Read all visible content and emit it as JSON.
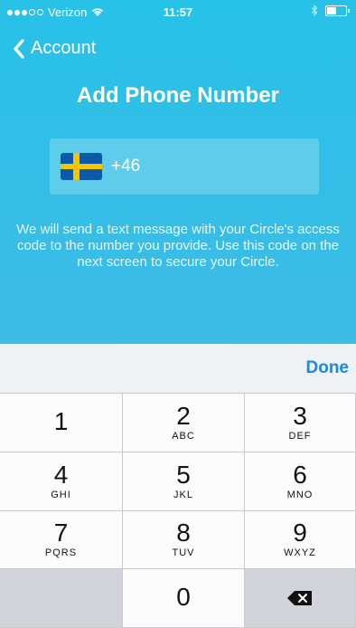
{
  "status": {
    "carrier": "Verizon",
    "time": "11:57"
  },
  "nav": {
    "back_label": "Account"
  },
  "page": {
    "title": "Add Phone Number",
    "phone_prefix": "+46",
    "info_text": "We will send a text message with your Circle's access code to the number you provide.  Use this code on the next screen to secure your Circle."
  },
  "keyboard": {
    "done_label": "Done",
    "keys": [
      {
        "num": "1",
        "letters": ""
      },
      {
        "num": "2",
        "letters": "ABC"
      },
      {
        "num": "3",
        "letters": "DEF"
      },
      {
        "num": "4",
        "letters": "GHI"
      },
      {
        "num": "5",
        "letters": "JKL"
      },
      {
        "num": "6",
        "letters": "MNO"
      },
      {
        "num": "7",
        "letters": "PQRS"
      },
      {
        "num": "8",
        "letters": "TUV"
      },
      {
        "num": "9",
        "letters": "WXYZ"
      },
      {
        "num": "0",
        "letters": ""
      }
    ]
  },
  "colors": {
    "background_top": "#27c1e8",
    "accent_done": "#1f88d8"
  }
}
